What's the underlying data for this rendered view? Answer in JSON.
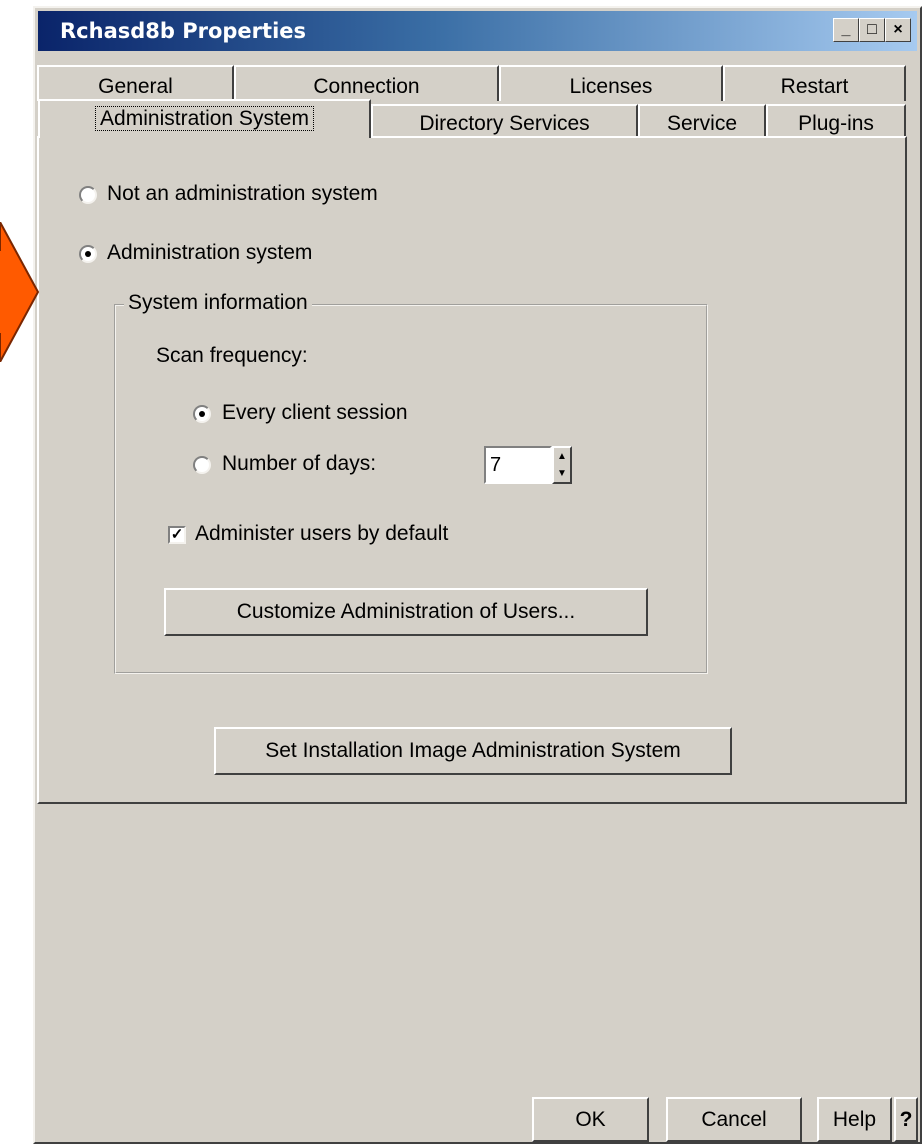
{
  "window": {
    "title": "Rchasd8b Properties",
    "controls": {
      "minimize": "_",
      "maximize": "□",
      "close": "×"
    }
  },
  "tabs": {
    "back_row": [
      "General",
      "Connection",
      "Licenses",
      "Restart"
    ],
    "front_row": [
      "Administration System",
      "Directory Services",
      "Service",
      "Plug-ins"
    ],
    "active": "Administration System"
  },
  "options": {
    "not_admin": "Not an administration system",
    "admin": "Administration system"
  },
  "system_info": {
    "title": "System information",
    "scan_frequency_label": "Scan frequency:",
    "every_client_session": "Every client session",
    "number_of_days": "Number of days:",
    "days_value": "7",
    "administer_users": "Administer users by default",
    "customize_button": "Customize Administration of Users..."
  },
  "set_installation_button": "Set Installation Image Administration System",
  "footer": {
    "ok": "OK",
    "cancel": "Cancel",
    "help": "Help",
    "question": "?"
  },
  "colors": {
    "arrow": "#ff5a00",
    "title_start": "#0a246a",
    "title_end": "#a6caf0",
    "dialog": "#d4d0c8"
  }
}
